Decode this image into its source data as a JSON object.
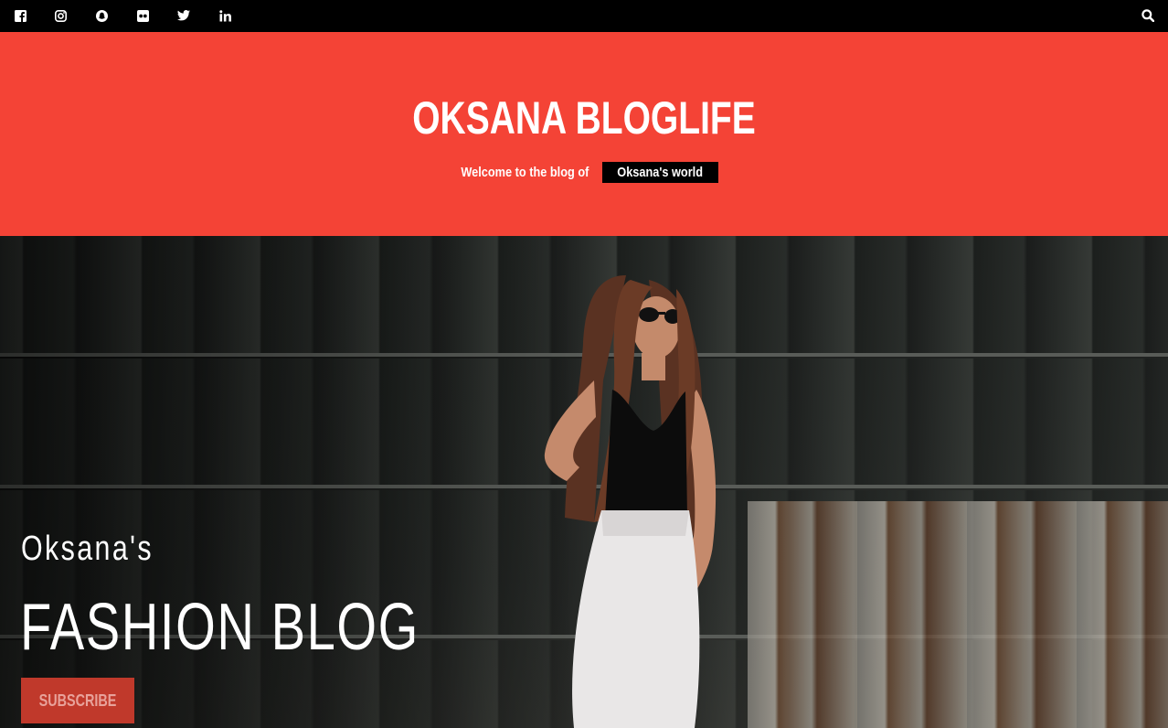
{
  "topbar": {
    "social_icons": [
      "facebook-icon",
      "instagram-icon",
      "snapchat-icon",
      "flickr-icon",
      "twitter-icon",
      "linkedin-icon"
    ],
    "search_icon": "search-icon"
  },
  "header": {
    "title": "OKSANA BLOGLIFE",
    "tagline_prefix": "Welcome to the blog of",
    "tagline_highlight": "Oksana's world",
    "background": "#f44336"
  },
  "hero": {
    "subtitle": "Oksana's",
    "title": "FASHION BLOG",
    "button_label": "SUBSCRIBE",
    "button_color": "#c0392b"
  }
}
